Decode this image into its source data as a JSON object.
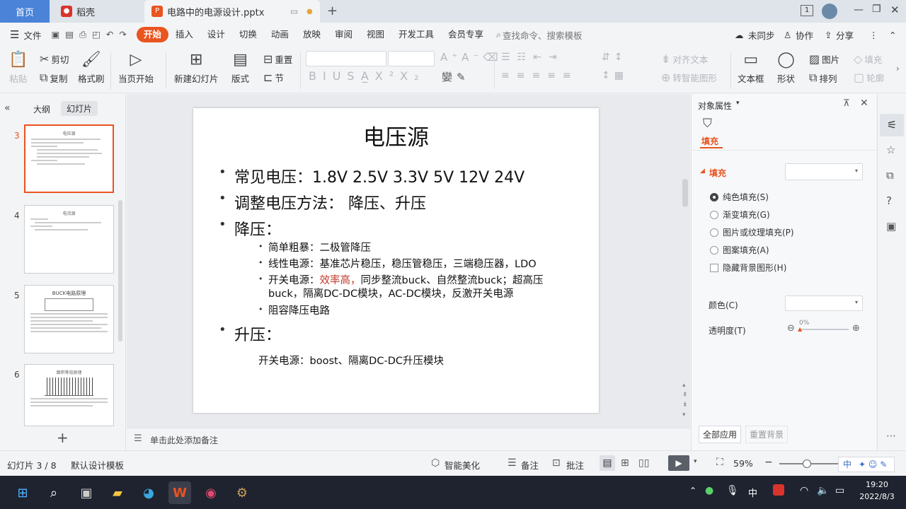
{
  "titlebar": {
    "home_tab": "首页",
    "daoke_tab": "稻壳",
    "doc_tab": "电路中的电源设计.pptx",
    "badge": "1"
  },
  "menu": {
    "file": "文件",
    "items": [
      "开始",
      "插入",
      "设计",
      "切换",
      "动画",
      "放映",
      "审阅",
      "视图",
      "开发工具",
      "会员专享"
    ],
    "search_placeholder": "查找命令、搜索模板",
    "unsync": "未同步",
    "collab": "协作",
    "share": "分享"
  },
  "ribbon": {
    "paste": "粘贴",
    "cut": "剪切",
    "copy": "复制",
    "format_painter": "格式刷",
    "play_current": "当页开始",
    "new_slide": "新建幻灯片",
    "layout": "版式",
    "reset": "重置",
    "section": "节",
    "align_text": "对齐文本",
    "smartart": "转智能图形",
    "textbox": "文本框",
    "shape": "形状",
    "picture": "图片",
    "arrange": "排列",
    "fill": "填充",
    "outline": "轮廓"
  },
  "leftpanel": {
    "tab_outline": "大纲",
    "tab_slides": "幻灯片",
    "thumbs": [
      {
        "num": "3",
        "title": "电压源"
      },
      {
        "num": "4",
        "title": "电流源"
      },
      {
        "num": "5",
        "title": "BUCK电路原理"
      },
      {
        "num": "6",
        "title": "面积等效原理"
      }
    ]
  },
  "slide": {
    "title": "电压源",
    "bullet1": "常见电压：1.8V 2.5V 3.3V 5V 12V 24V",
    "bullet2": "调整电压方法： 降压、升压",
    "bullet3": "降压：",
    "sub1": "简单粗暴：二极管降压",
    "sub2": "线性电源：基准芯片稳压，稳压管稳压，三端稳压器，LDO",
    "sub3_a": "开关电源：",
    "sub3_red": "效率高，",
    "sub3_b": "同步整流buck、自然整流buck；超高压",
    "sub3_c": "buck，隔离DC-DC模块，AC-DC模块，反激开关电源",
    "sub4": "阻容降压电路",
    "bullet4": "升压：",
    "boost": "开关电源：boost、隔离DC-DC升压模块",
    "red_color": "#c0392b"
  },
  "notes": {
    "placeholder": "单击此处添加备注"
  },
  "rightpanel": {
    "title": "对象属性",
    "tab_fill": "填充",
    "section_fill": "填充",
    "opt_solid": "纯色填充(S)",
    "opt_gradient": "渐变填充(G)",
    "opt_picture": "图片或纹理填充(P)",
    "opt_pattern": "图案填充(A)",
    "opt_hide_bg": "隐藏背景图形(H)",
    "color_label": "颜色(C)",
    "transparency_label": "透明度(T)",
    "transparency_value": "0%",
    "apply_all": "全部应用",
    "reset_bg": "重置背景"
  },
  "status": {
    "slide_count": "幻灯片 3 / 8",
    "template": "默认设计模板",
    "beautify": "智能美化",
    "notes": "备注",
    "comment": "批注",
    "zoom": "59%",
    "ime": "中"
  },
  "taskbar": {
    "ime": "中",
    "time": "19:20",
    "date": "2022/8/3"
  },
  "accent": "#e9541f"
}
